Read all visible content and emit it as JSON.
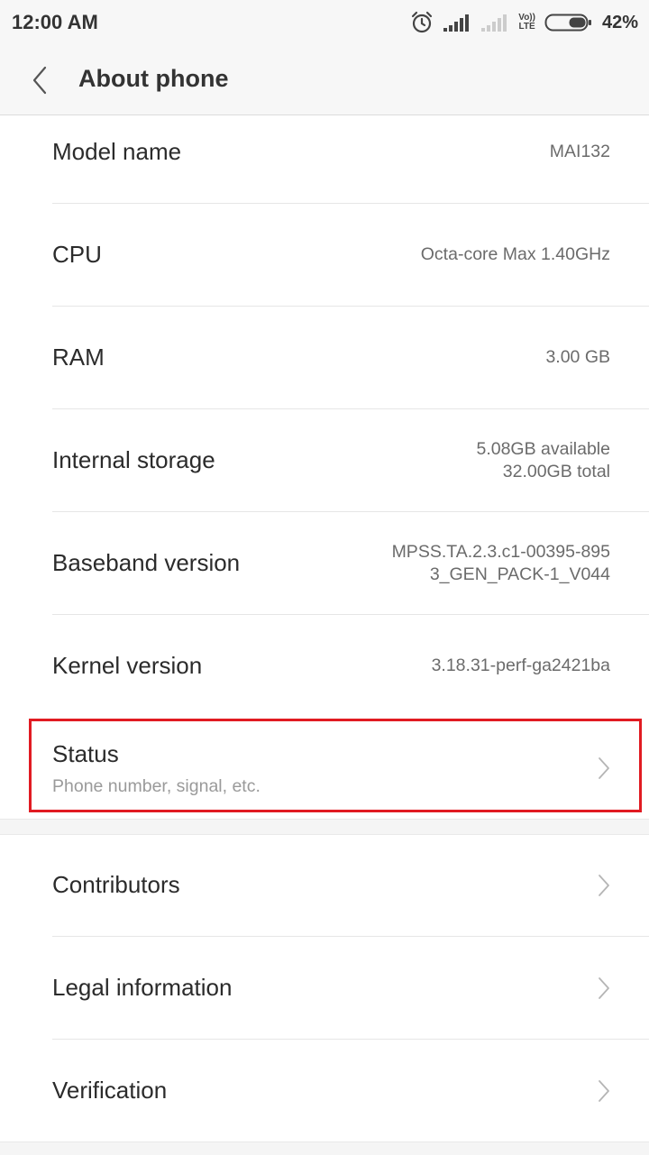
{
  "status_bar": {
    "time": "12:00 AM",
    "volte_top": "Vo))",
    "volte_bottom": "LTE",
    "battery_percent": "42%",
    "battery_level": 0.42,
    "icons": [
      "alarm-icon",
      "signal-full-icon",
      "signal-weak-icon",
      "volte-icon",
      "battery-icon"
    ]
  },
  "header": {
    "title": "About phone",
    "back_icon": "chevron-left-icon"
  },
  "info_rows": [
    {
      "label": "Model name",
      "value_lines": [
        "MAI132"
      ]
    },
    {
      "label": "CPU",
      "value_lines": [
        "Octa-core Max 1.40GHz"
      ]
    },
    {
      "label": "RAM",
      "value_lines": [
        "3.00 GB"
      ]
    },
    {
      "label": "Internal storage",
      "value_lines": [
        "5.08GB available",
        "32.00GB total"
      ]
    },
    {
      "label": "Baseband version",
      "value_lines": [
        "MPSS.TA.2.3.c1-00395-895",
        "3_GEN_PACK-1_V044"
      ]
    },
    {
      "label": "Kernel version",
      "value_lines": [
        "3.18.31-perf-ga2421ba"
      ]
    }
  ],
  "status_item": {
    "title": "Status",
    "subtitle": "Phone number, signal, etc.",
    "highlight_color": "#e11b22"
  },
  "nav_rows": [
    {
      "label": "Contributors"
    },
    {
      "label": "Legal information"
    },
    {
      "label": "Verification"
    }
  ],
  "colors": {
    "background": "#ffffff",
    "bar_background": "#f7f7f7",
    "primary_text": "#2b2b2b",
    "secondary_text": "#6b6b6b",
    "highlight": "#e11b22"
  }
}
